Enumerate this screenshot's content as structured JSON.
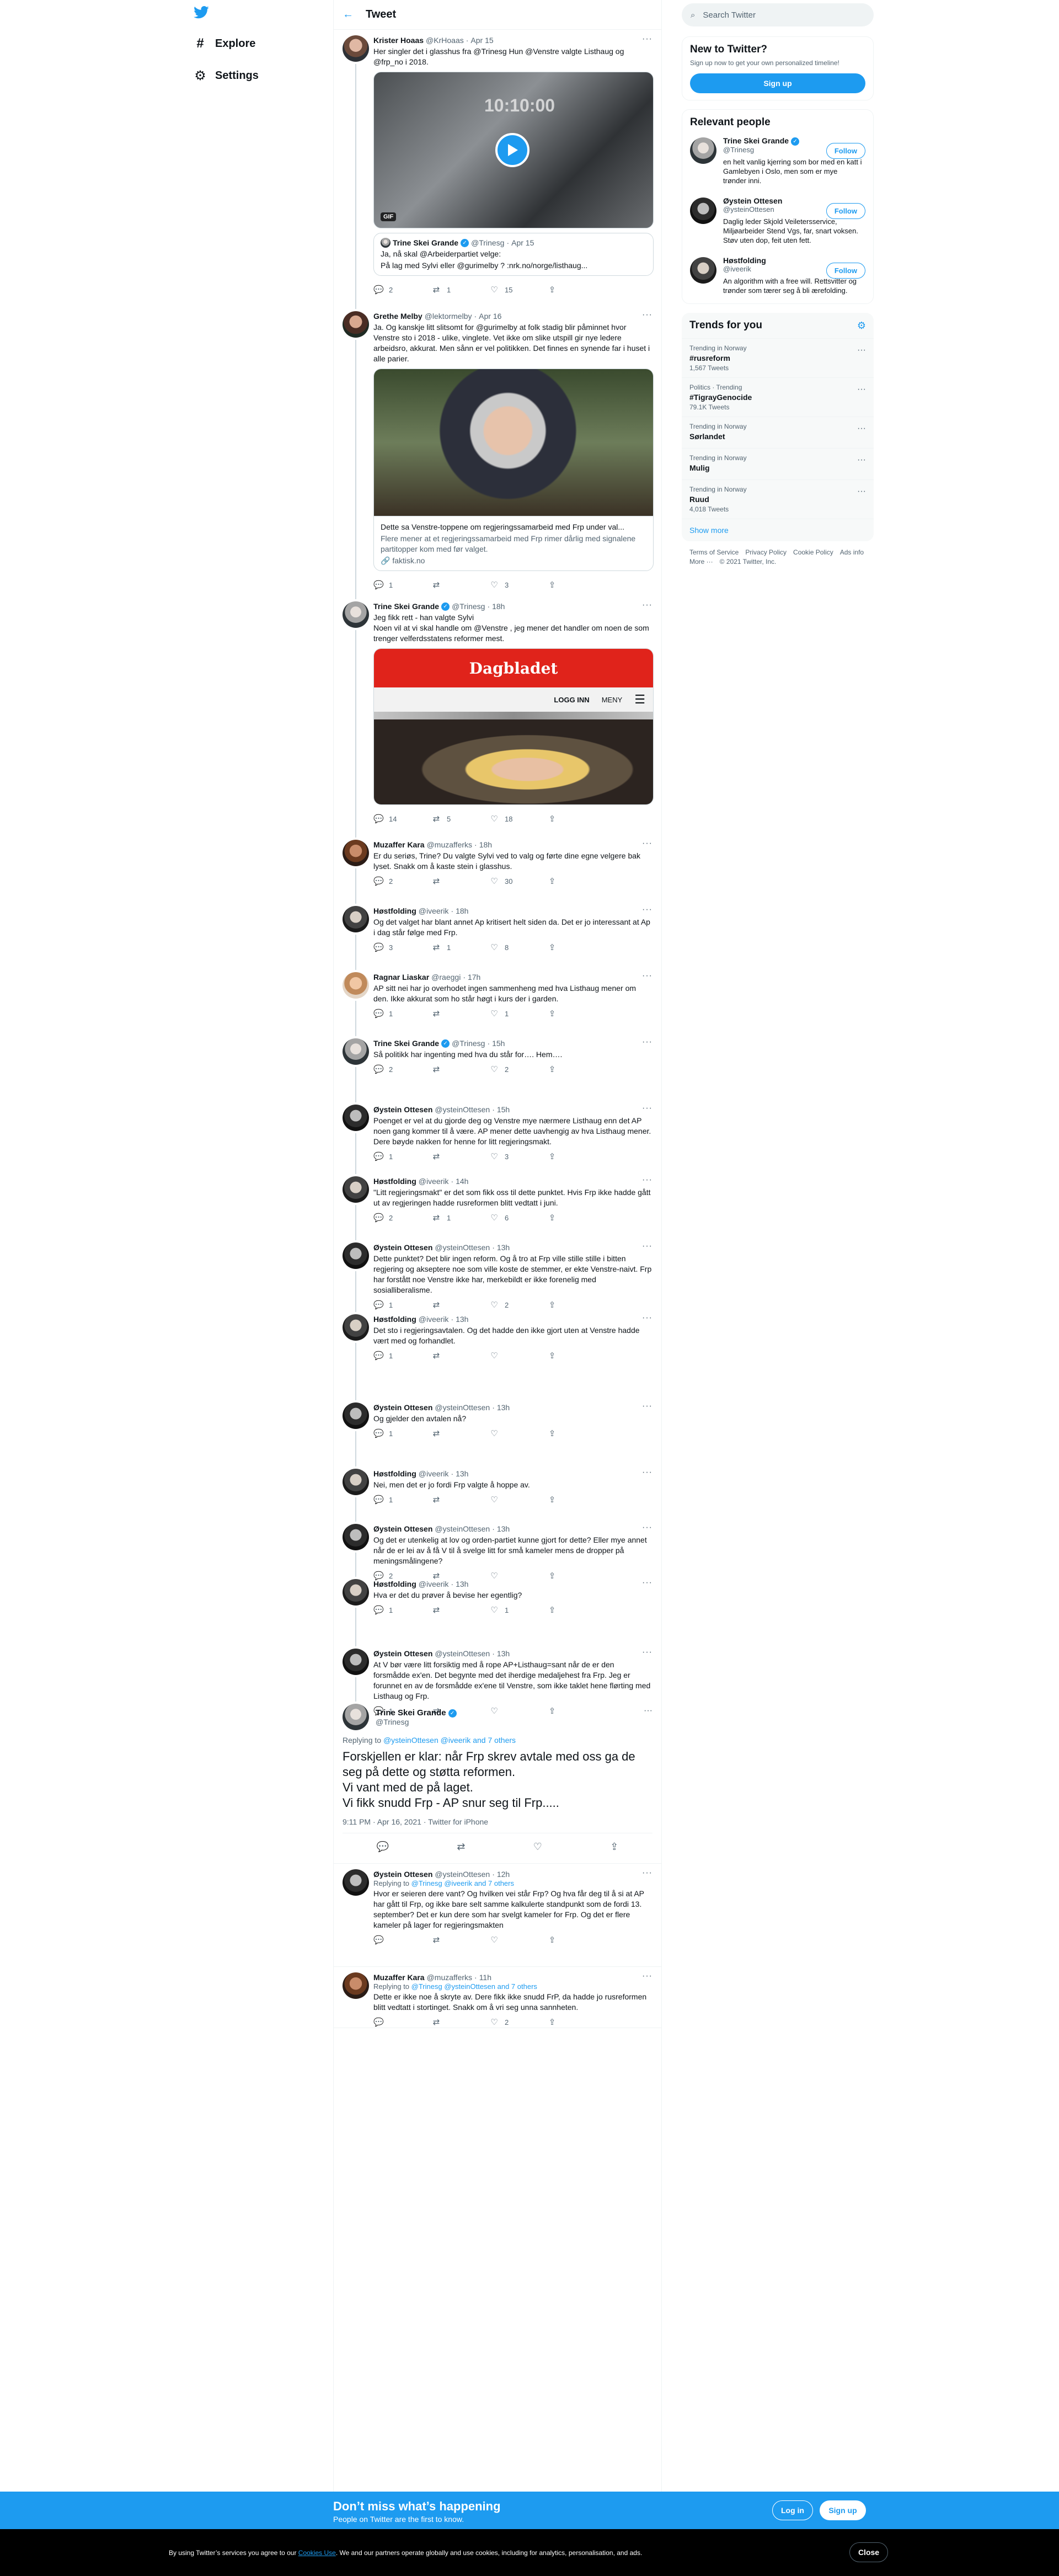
{
  "nav": {
    "explore": "Explore",
    "settings": "Settings"
  },
  "header": {
    "title": "Tweet"
  },
  "tweets": [
    {
      "name": "Krister Hoaas",
      "handle": "@KrHoaas",
      "date": "Apr 15",
      "text": "Her singler det i glasshus fra @Trinesg Hun @Venstre valgte Listhaug og @frp_no i 2018.",
      "media_badge": "GIF",
      "media_stamp": "10:10:00",
      "quote": {
        "name": "Trine Skei Grande",
        "handle": "@Trinesg",
        "date": "Apr 15",
        "line1": "Ja, nå skal @Arbeiderpartiet velge:",
        "line2": "På lag med Sylvi eller @gurimelby ? :nrk.no/norge/listhaug..."
      },
      "replies": "2",
      "retweets": "1",
      "likes": "15"
    },
    {
      "name": "Grethe Melby",
      "handle": "@lektormelby",
      "date": "Apr 16",
      "text": "Ja. Og kanskje litt slitsomt for @gurimelby at folk stadig blir påminnet hvor Venstre sto i 2018 - ulike, vinglete. Vet ikke om slike utspill gir nye ledere arbeidsro, akkurat. Men sånn er vel politikken. Det finnes en synende far i huset i alle parier.",
      "card_title": "Dette sa Venstre-toppene om regjeringssamarbeid med Frp under val...",
      "card_desc": "Flere mener at et regjeringssamarbeid med Frp rimer dårlig med signalene partitopper kom med før valget.",
      "card_domain": "faktisk.no",
      "replies": "1",
      "retweets": "",
      "likes": "3"
    },
    {
      "name": "Trine Skei Grande",
      "handle": "@Trinesg",
      "date": "18h",
      "text": "Jeg fikk rett - han valgte Sylvi\nNoen vil at vi skal handle om @Venstre , jeg mener det handler om noen de som trenger velferdsstatens reformer mest.",
      "card_brand": "Dagbladet",
      "card_login": "LOGG INN",
      "card_menu": "MENY",
      "replies": "14",
      "retweets": "5",
      "likes": "18"
    },
    {
      "name": "Muzaffer Kara",
      "handle": "@muzafferks",
      "date": "18h",
      "text": "Er du seriøs, Trine? Du valgte Sylvi ved to valg og førte dine egne velgere bak lyset. Snakk om å kaste stein i glasshus.",
      "replies": "2",
      "retweets": "",
      "likes": "30"
    },
    {
      "name": "Høstfolding",
      "handle": "@iveerik",
      "date": "18h",
      "text": "Og det valget har blant annet Ap kritisert helt siden da. Det er jo interessant at Ap i dag står følge med Frp.",
      "replies": "3",
      "retweets": "1",
      "likes": "8"
    },
    {
      "name": "Ragnar Liaskar",
      "handle": "@raeggi",
      "date": "17h",
      "text": "AP sitt nei har jo overhodet ingen sammenheng med hva Listhaug mener om den. Ikke akkurat som ho står høgt i kurs der i garden.",
      "replies": "1",
      "retweets": "",
      "likes": "1"
    },
    {
      "name": "Trine Skei Grande",
      "handle": "@Trinesg",
      "date": "15h",
      "text": "Så politikk har ingenting med hva du står for…. Hem….",
      "replies": "2",
      "retweets": "",
      "likes": "2"
    },
    {
      "name": "Øystein Ottesen",
      "handle": "@ysteinOttesen",
      "date": "15h",
      "text": "Poenget er vel at du gjorde deg og Venstre mye nærmere Listhaug enn det AP noen gang kommer til å være. AP mener dette uavhengig av hva Listhaug mener. Dere bøyde nakken for henne for litt regjeringsmakt.",
      "replies": "1",
      "retweets": "",
      "likes": "3"
    },
    {
      "name": "Høstfolding",
      "handle": "@iveerik",
      "date": "14h",
      "text": "\"Litt regjeringsmakt\" er det som fikk oss til dette punktet. Hvis Frp ikke hadde gått ut av regjeringen hadde rusreformen blitt vedtatt i juni.",
      "replies": "2",
      "retweets": "1",
      "likes": "6"
    },
    {
      "name": "Øystein Ottesen",
      "handle": "@ysteinOttesen",
      "date": "13h",
      "text": "Dette punktet? Det blir ingen reform. Og å tro at Frp ville stille stille i bitten regjering og akseptere noe som ville koste de stemmer, er ekte Venstre-naivt. Frp har forstått noe Venstre ikke har, merkebildt er ikke forenelig med sosialliberalisme.",
      "replies": "1",
      "retweets": "",
      "likes": "2"
    },
    {
      "name": "Høstfolding",
      "handle": "@iveerik",
      "date": "13h",
      "text": "Det sto i regjeringsavtalen. Og det hadde den ikke gjort uten at Venstre hadde vært med og forhandlet.",
      "replies": "1",
      "retweets": "",
      "likes": ""
    },
    {
      "name": "Øystein Ottesen",
      "handle": "@ysteinOttesen",
      "date": "13h",
      "text": "Og gjelder den avtalen nå?",
      "replies": "1",
      "retweets": "",
      "likes": ""
    },
    {
      "name": "Høstfolding",
      "handle": "@iveerik",
      "date": "13h",
      "text": "Nei, men det er jo fordi Frp valgte å hoppe av.",
      "replies": "1",
      "retweets": "",
      "likes": ""
    },
    {
      "name": "Øystein Ottesen",
      "handle": "@ysteinOttesen",
      "date": "13h",
      "text": "Og det er utenkelig at lov og orden-partiet kunne gjort for dette? Eller mye annet når de er lei av å få V til å svelge litt for små kameler mens de dropper på meningsmålingene?",
      "replies": "2",
      "retweets": "",
      "likes": ""
    },
    {
      "name": "Høstfolding",
      "handle": "@iveerik",
      "date": "13h",
      "text": "Hva er det du prøver å bevise her egentlig?",
      "replies": "1",
      "retweets": "",
      "likes": "1"
    },
    {
      "name": "Øystein Ottesen",
      "handle": "@ysteinOttesen",
      "date": "13h",
      "text": "At V bør være litt forsiktig med å rope AP+Listhaug=sant når de er den forsmådde ex'en. Det begynte med det iherdige medaljehest fra Frp. Jeg er forunnet en av de forsmådde ex'ene til Venstre, som ikke taklet hene flørting med Listhaug og Frp.",
      "replies": "1",
      "retweets": "",
      "likes": ""
    }
  ],
  "focus": {
    "name": "Trine Skei Grande",
    "handle": "@Trinesg",
    "replying_label": "Replying to",
    "replying_to": "@ysteinOttesen @iveerik and 7 others",
    "lines": [
      "Forskjellen er klar: når Frp skrev avtale med oss ga de seg på dette og støtta reformen.",
      "Vi vant med de på laget.",
      "Vi fikk snudd Frp - AP snur seg til Frp....."
    ],
    "timestamp": "9:11 PM · Apr 16, 2021 · Twitter for iPhone"
  },
  "replies_after": [
    {
      "name": "Øystein Ottesen",
      "handle": "@ysteinOttesen",
      "date": "12h",
      "replying_to": "@Trinesg @iveerik and 7 others",
      "text": "Hvor er seieren dere vant? Og hvilken vei står Frp? Og hva får deg til å si at AP har gått til Frp, og ikke bare selt samme kalkulerte standpunkt som de fordi 13. september? Det er kun dere som har svelgt kameler for Frp. Og det er flere kameler på lager for regjeringsmakten",
      "replies": "",
      "retweets": "",
      "likes": ""
    },
    {
      "name": "Muzaffer Kara",
      "handle": "@muzafferks",
      "date": "11h",
      "replying_to": "@Trinesg @ysteinOttesen and 7 others",
      "text": "Dette er ikke noe å skryte av. Dere fikk ikke snudd FrP, da hadde jo rusreformen blitt vedtatt i stortinget. Snakk om å vri seg unna sannheten.",
      "replies": "",
      "retweets": "",
      "likes": "2"
    }
  ],
  "right": {
    "search_placeholder": "Search Twitter",
    "new_title": "New to Twitter?",
    "new_sub": "Sign up now to get your own personalized timeline!",
    "signup": "Sign up",
    "relevant_title": "Relevant people",
    "people": [
      {
        "name": "Trine Skei Grande",
        "handle": "@Trinesg",
        "bio": "en helt vanlig kjerring som bor med en katt i Gamlebyen i Oslo, men som er mye trønder inni.",
        "follow": "Follow"
      },
      {
        "name": "Øystein Ottesen",
        "handle": "@ysteinOttesen",
        "bio": "Daglig leder Skjold Veiletersservice, Miljøarbeider Stend Vgs, far, snart voksen. Støv uten dop, feit uten fett.",
        "follow": "Follow"
      },
      {
        "name": "Høstfolding",
        "handle": "@iveerik",
        "bio": "An algorithm with a free will. Rettsvitter og trønder som tærer seg å bli ærefolding.",
        "follow": "Follow"
      }
    ],
    "trends_title": "Trends for you",
    "trends": [
      {
        "ctx": "Trending in Norway",
        "name": "#rusreform",
        "count": "1,567 Tweets"
      },
      {
        "ctx": "Politics · Trending",
        "name": "#TigrayGenocide",
        "count": "79.1K Tweets"
      },
      {
        "ctx": "Trending in Norway",
        "name": "Sørlandet",
        "count": ""
      },
      {
        "ctx": "Trending in Norway",
        "name": "Mulig",
        "count": ""
      },
      {
        "ctx": "Trending in Norway",
        "name": "Ruud",
        "count": "4,018 Tweets"
      }
    ],
    "show_more": "Show more",
    "footer": [
      "Terms of Service",
      "Privacy Policy",
      "Cookie Policy",
      "Ads info",
      "More ···",
      "© 2021 Twitter, Inc."
    ]
  },
  "bottom": {
    "title": "Don’t miss what’s happening",
    "sub": "People on Twitter are the first to know.",
    "login": "Log in",
    "signup": "Sign up"
  },
  "cookie": {
    "text": "By using Twitter’s services you agree to our",
    "link": "Cookies Use",
    "rest": ". We and our partners operate globally and use cookies, including for analytics, personalisation, and ads.",
    "close": "Close"
  },
  "colors": {
    "accent": "#1d9bf0",
    "text": "#0f1419",
    "muted": "#536471"
  }
}
